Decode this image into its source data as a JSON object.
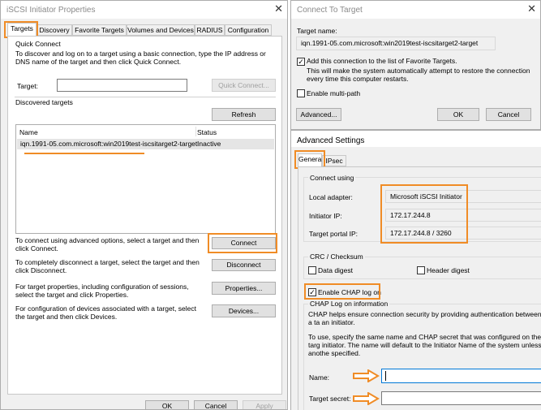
{
  "left_window": {
    "title": "iSCSI Initiator Properties",
    "tabs": [
      "Targets",
      "Discovery",
      "Favorite Targets",
      "Volumes and Devices",
      "RADIUS",
      "Configuration"
    ],
    "quick_connect": {
      "label": "Quick Connect",
      "description": "To discover and log on to a target using a basic connection, type the IP address or DNS name of the target and then click Quick Connect.",
      "target_label": "Target:",
      "target_value": "",
      "button": "Quick Connect..."
    },
    "discovered": {
      "label": "Discovered targets",
      "refresh": "Refresh",
      "columns": [
        "Name",
        "Status"
      ],
      "rows": [
        {
          "name": "iqn.1991-05.com.microsoft:win2019test-iscsitarget2-target",
          "status": "Inactive"
        }
      ]
    },
    "actions": [
      {
        "text": "To connect using advanced options, select a target and then click Connect.",
        "button": "Connect"
      },
      {
        "text": "To completely disconnect a target, select the target and then click Disconnect.",
        "button": "Disconnect"
      },
      {
        "text": "For target properties, including configuration of sessions, select the target and click Properties.",
        "button": "Properties..."
      },
      {
        "text": "For configuration of devices associated with a target, select the target and then click Devices.",
        "button": "Devices..."
      }
    ],
    "footer": {
      "ok": "OK",
      "cancel": "Cancel",
      "apply": "Apply"
    }
  },
  "connect_window": {
    "title": "Connect To Target",
    "target_name_label": "Target name:",
    "target_name_value": "iqn.1991-05.com.microsoft:win2019test-iscsitarget2-target",
    "favorite_label": "Add this connection to the list of Favorite Targets.",
    "favorite_note": "This will make the system automatically attempt to restore the connection every time this computer restarts.",
    "multipath_label": "Enable multi-path",
    "advanced": "Advanced...",
    "ok": "OK",
    "cancel": "Cancel"
  },
  "advanced_window": {
    "title": "Advanced Settings",
    "tabs": [
      "General",
      "IPsec"
    ],
    "connect_using": {
      "label": "Connect using",
      "local_adapter_label": "Local adapter:",
      "local_adapter_value": "Microsoft iSCSI Initiator",
      "initiator_ip_label": "Initiator IP:",
      "initiator_ip_value": "172.17.244.8",
      "portal_ip_label": "Target portal IP:",
      "portal_ip_value": "172.17.244.8 / 3260"
    },
    "crc": {
      "label": "CRC / Checksum",
      "data_digest": "Data digest",
      "header_digest": "Header digest"
    },
    "chap": {
      "enable_label": "Enable CHAP log on",
      "group_label": "CHAP Log on information",
      "help1": "CHAP helps ensure connection security by providing authentication between a ta an initiator.",
      "help2": "To use, specify the same name and CHAP secret that was configured on the targ initiator.  The name will default to the Initiator Name of the system unless anothe specified.",
      "name_label": "Name:",
      "name_value": "",
      "secret_label": "Target secret:",
      "secret_value": ""
    }
  },
  "colors": {
    "highlight": "#f08c26"
  }
}
